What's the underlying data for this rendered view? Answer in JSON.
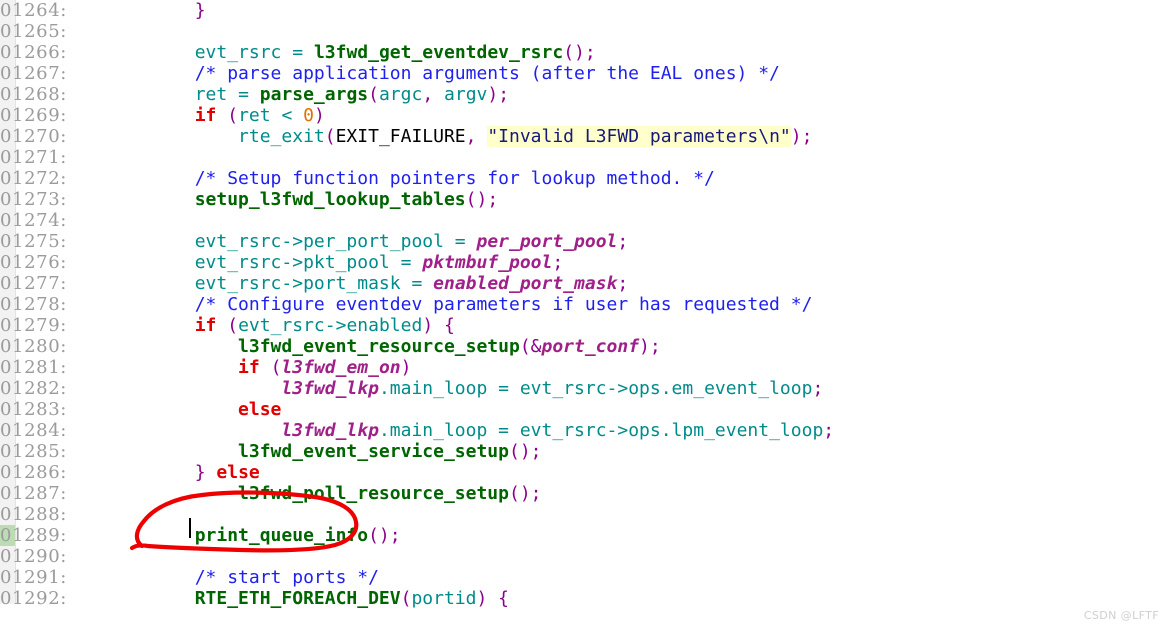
{
  "editor": {
    "gutter_suffix": ":",
    "first_line_number": 1264,
    "line_height_px": 21,
    "change_marker_line": 1289
  },
  "colors": {
    "background": "#ffffff",
    "gutter_strip": "#f2f2f2",
    "change_marker": "#bcdcb4",
    "line_number": "#9b9b9b",
    "identifier": "#008b8b",
    "function": "#006400",
    "comment": "#2020ee",
    "keyword": "#e00000",
    "number": "#e07000",
    "punctuation": "#8b008b",
    "global_variable": "#a0208a",
    "string_text": "#181878",
    "string_highlight_bg": "#ffffcc",
    "annotation": "#ee0000",
    "watermark": "#cfcfcf"
  },
  "watermark": {
    "text": "CSDN @LFTF"
  },
  "annotation": {
    "shape": "hand-drawn-ellipse",
    "color": "#ee0000",
    "encircles": "print_queue_info();"
  },
  "lines": [
    {
      "number": "01264",
      "tokens": [
        {
          "t": "plain",
          "s": "        "
        },
        {
          "t": "punc",
          "s": "}"
        }
      ]
    },
    {
      "number": "01265",
      "tokens": []
    },
    {
      "number": "01266",
      "tokens": [
        {
          "t": "plain",
          "s": "        "
        },
        {
          "t": "var",
          "s": "evt_rsrc"
        },
        {
          "t": "plain",
          "s": " "
        },
        {
          "t": "var",
          "s": "="
        },
        {
          "t": "plain",
          "s": " "
        },
        {
          "t": "func",
          "s": "l3fwd_get_eventdev_rsrc"
        },
        {
          "t": "punc",
          "s": "();"
        }
      ]
    },
    {
      "number": "01267",
      "tokens": [
        {
          "t": "plain",
          "s": "        "
        },
        {
          "t": "comment",
          "s": "/* parse application arguments (after the EAL ones) */"
        }
      ]
    },
    {
      "number": "01268",
      "tokens": [
        {
          "t": "plain",
          "s": "        "
        },
        {
          "t": "var",
          "s": "ret"
        },
        {
          "t": "plain",
          "s": " "
        },
        {
          "t": "var",
          "s": "="
        },
        {
          "t": "plain",
          "s": " "
        },
        {
          "t": "func",
          "s": "parse_args"
        },
        {
          "t": "punc",
          "s": "("
        },
        {
          "t": "var",
          "s": "argc"
        },
        {
          "t": "punc",
          "s": ","
        },
        {
          "t": "plain",
          "s": " "
        },
        {
          "t": "var",
          "s": "argv"
        },
        {
          "t": "punc",
          "s": ");"
        }
      ]
    },
    {
      "number": "01269",
      "tokens": [
        {
          "t": "plain",
          "s": "        "
        },
        {
          "t": "key",
          "s": "if"
        },
        {
          "t": "plain",
          "s": " "
        },
        {
          "t": "punc",
          "s": "("
        },
        {
          "t": "var",
          "s": "ret"
        },
        {
          "t": "plain",
          "s": " "
        },
        {
          "t": "var",
          "s": "<"
        },
        {
          "t": "plain",
          "s": " "
        },
        {
          "t": "num",
          "s": "0"
        },
        {
          "t": "punc",
          "s": ")"
        }
      ]
    },
    {
      "number": "01270",
      "tokens": [
        {
          "t": "plain",
          "s": "            "
        },
        {
          "t": "var",
          "s": "rte_exit"
        },
        {
          "t": "punc",
          "s": "("
        },
        {
          "t": "const",
          "s": "EXIT_FAILURE"
        },
        {
          "t": "punc",
          "s": ","
        },
        {
          "t": "plain",
          "s": " "
        },
        {
          "t": "str",
          "s": "\"Invalid L3FWD parameters\\n\""
        },
        {
          "t": "punc",
          "s": ");"
        }
      ]
    },
    {
      "number": "01271",
      "tokens": []
    },
    {
      "number": "01272",
      "tokens": [
        {
          "t": "plain",
          "s": "        "
        },
        {
          "t": "comment",
          "s": "/* Setup function pointers for lookup method. */"
        }
      ]
    },
    {
      "number": "01273",
      "tokens": [
        {
          "t": "plain",
          "s": "        "
        },
        {
          "t": "func",
          "s": "setup_l3fwd_lookup_tables"
        },
        {
          "t": "punc",
          "s": "();"
        }
      ]
    },
    {
      "number": "01274",
      "tokens": []
    },
    {
      "number": "01275",
      "tokens": [
        {
          "t": "plain",
          "s": "        "
        },
        {
          "t": "var",
          "s": "evt_rsrc->per_port_pool"
        },
        {
          "t": "plain",
          "s": " "
        },
        {
          "t": "var",
          "s": "="
        },
        {
          "t": "plain",
          "s": " "
        },
        {
          "t": "gvar",
          "s": "per_port_pool"
        },
        {
          "t": "punc",
          "s": ";"
        }
      ]
    },
    {
      "number": "01276",
      "tokens": [
        {
          "t": "plain",
          "s": "        "
        },
        {
          "t": "var",
          "s": "evt_rsrc->pkt_pool"
        },
        {
          "t": "plain",
          "s": " "
        },
        {
          "t": "var",
          "s": "="
        },
        {
          "t": "plain",
          "s": " "
        },
        {
          "t": "gvar",
          "s": "pktmbuf_pool"
        },
        {
          "t": "punc",
          "s": ";"
        }
      ]
    },
    {
      "number": "01277",
      "tokens": [
        {
          "t": "plain",
          "s": "        "
        },
        {
          "t": "var",
          "s": "evt_rsrc->port_mask"
        },
        {
          "t": "plain",
          "s": " "
        },
        {
          "t": "var",
          "s": "="
        },
        {
          "t": "plain",
          "s": " "
        },
        {
          "t": "gvar",
          "s": "enabled_port_mask"
        },
        {
          "t": "punc",
          "s": ";"
        }
      ]
    },
    {
      "number": "01278",
      "tokens": [
        {
          "t": "plain",
          "s": "        "
        },
        {
          "t": "comment",
          "s": "/* Configure eventdev parameters if user has requested */"
        }
      ]
    },
    {
      "number": "01279",
      "tokens": [
        {
          "t": "plain",
          "s": "        "
        },
        {
          "t": "key",
          "s": "if"
        },
        {
          "t": "plain",
          "s": " "
        },
        {
          "t": "punc",
          "s": "("
        },
        {
          "t": "var",
          "s": "evt_rsrc->enabled"
        },
        {
          "t": "punc",
          "s": ")"
        },
        {
          "t": "plain",
          "s": " "
        },
        {
          "t": "punc",
          "s": "{"
        }
      ]
    },
    {
      "number": "01280",
      "tokens": [
        {
          "t": "plain",
          "s": "            "
        },
        {
          "t": "func",
          "s": "l3fwd_event_resource_setup"
        },
        {
          "t": "punc",
          "s": "(&"
        },
        {
          "t": "gvar",
          "s": "port_conf"
        },
        {
          "t": "punc",
          "s": ");"
        }
      ]
    },
    {
      "number": "01281",
      "tokens": [
        {
          "t": "plain",
          "s": "            "
        },
        {
          "t": "key",
          "s": "if"
        },
        {
          "t": "plain",
          "s": " "
        },
        {
          "t": "punc",
          "s": "("
        },
        {
          "t": "gvar",
          "s": "l3fwd_em_on"
        },
        {
          "t": "punc",
          "s": ")"
        }
      ]
    },
    {
      "number": "01282",
      "tokens": [
        {
          "t": "plain",
          "s": "                "
        },
        {
          "t": "gvar",
          "s": "l3fwd_lkp"
        },
        {
          "t": "var",
          "s": ".main_loop"
        },
        {
          "t": "plain",
          "s": " "
        },
        {
          "t": "var",
          "s": "="
        },
        {
          "t": "plain",
          "s": " "
        },
        {
          "t": "var",
          "s": "evt_rsrc->ops.em_event_loop"
        },
        {
          "t": "punc",
          "s": ";"
        }
      ]
    },
    {
      "number": "01283",
      "tokens": [
        {
          "t": "plain",
          "s": "            "
        },
        {
          "t": "key",
          "s": "else"
        }
      ]
    },
    {
      "number": "01284",
      "tokens": [
        {
          "t": "plain",
          "s": "                "
        },
        {
          "t": "gvar",
          "s": "l3fwd_lkp"
        },
        {
          "t": "var",
          "s": ".main_loop"
        },
        {
          "t": "plain",
          "s": " "
        },
        {
          "t": "var",
          "s": "="
        },
        {
          "t": "plain",
          "s": " "
        },
        {
          "t": "var",
          "s": "evt_rsrc->ops.lpm_event_loop"
        },
        {
          "t": "punc",
          "s": ";"
        }
      ]
    },
    {
      "number": "01285",
      "tokens": [
        {
          "t": "plain",
          "s": "            "
        },
        {
          "t": "func",
          "s": "l3fwd_event_service_setup"
        },
        {
          "t": "punc",
          "s": "();"
        }
      ]
    },
    {
      "number": "01286",
      "tokens": [
        {
          "t": "plain",
          "s": "        "
        },
        {
          "t": "punc",
          "s": "}"
        },
        {
          "t": "plain",
          "s": " "
        },
        {
          "t": "key",
          "s": "else"
        }
      ]
    },
    {
      "number": "01287",
      "tokens": [
        {
          "t": "plain",
          "s": "            "
        },
        {
          "t": "func",
          "s": "l3fwd_poll_resource_setup"
        },
        {
          "t": "punc",
          "s": "();"
        }
      ]
    },
    {
      "number": "01288",
      "tokens": []
    },
    {
      "number": "01289",
      "tokens": [
        {
          "t": "plain",
          "s": "        "
        },
        {
          "t": "func",
          "s": "print_queue_info"
        },
        {
          "t": "punc",
          "s": "();"
        }
      ]
    },
    {
      "number": "01290",
      "tokens": []
    },
    {
      "number": "01291",
      "tokens": [
        {
          "t": "plain",
          "s": "        "
        },
        {
          "t": "comment",
          "s": "/* start ports */"
        }
      ]
    },
    {
      "number": "01292",
      "tokens": [
        {
          "t": "plain",
          "s": "        "
        },
        {
          "t": "func",
          "s": "RTE_ETH_FOREACH_DEV"
        },
        {
          "t": "punc",
          "s": "("
        },
        {
          "t": "var",
          "s": "portid"
        },
        {
          "t": "punc",
          "s": ")"
        },
        {
          "t": "plain",
          "s": " "
        },
        {
          "t": "punc",
          "s": "{"
        }
      ]
    }
  ]
}
